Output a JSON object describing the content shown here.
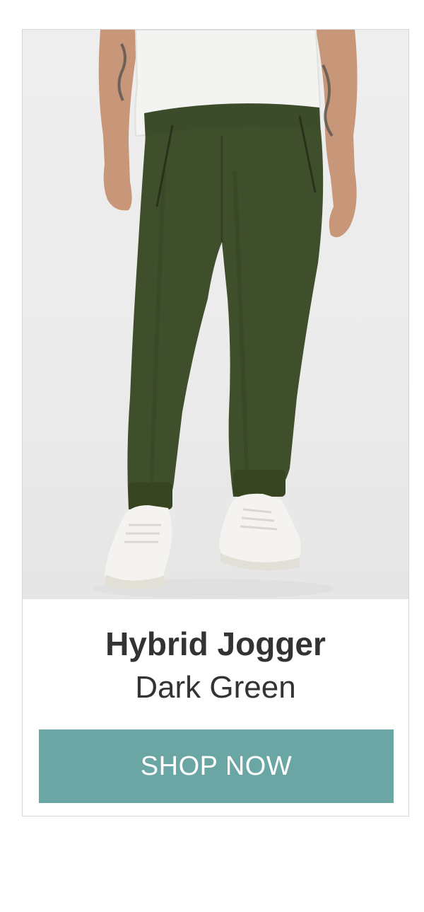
{
  "product": {
    "name": "Hybrid Jogger",
    "color": "Dark Green",
    "image_icon": "product-photo-jogger-pants"
  },
  "cta": {
    "label": "SHOP NOW",
    "background": "#6aa6a4"
  },
  "colors": {
    "text": "#333333",
    "pants": "#3f4f2c",
    "border": "#d6d6d6"
  }
}
